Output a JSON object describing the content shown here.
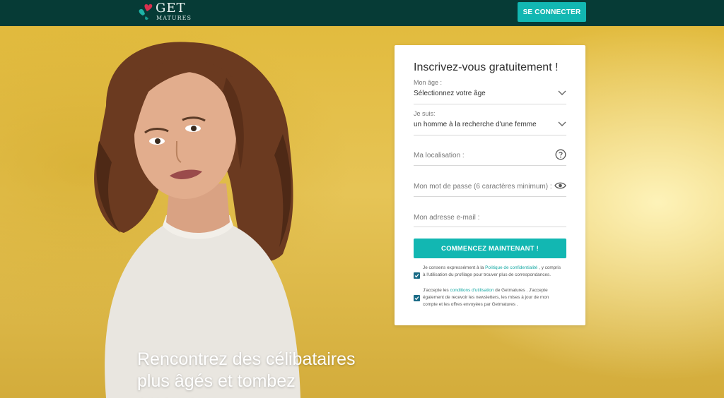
{
  "header": {
    "logo_word": "GET",
    "logo_sub": "MATURES",
    "login_button": "SE CONNECTER"
  },
  "hero": {
    "headline": "Rencontrez des célibataires plus âgés et tombez amoureux"
  },
  "form": {
    "title": "Inscrivez-vous gratuitement !",
    "age_label": "Mon âge :",
    "age_value": "Sélectionnez votre âge",
    "iam_label": "Je suis:",
    "iam_value": "un homme à la recherche d'une femme",
    "location_placeholder": "Ma localisation :",
    "password_placeholder": "Mon mot de passe (6 caractères minimum) :",
    "email_placeholder": "Mon adresse e-mail :",
    "submit_label": "COMMENCEZ MAINTENANT !",
    "consent1_pre": "Je consens expressément à la ",
    "consent1_link": "Politique de confidentialité",
    "consent1_post": " , y compris à l'utilisation du profilage pour trouver plus de correspondances.",
    "consent2_pre": "J'accepte les ",
    "consent2_link": "conditions d'utilisation",
    "consent2_post": " de Getmatures . J'accepte également de recevoir les newsletters, les mises à jour de mon compte et les offres envoyées par Getmatures ."
  },
  "colors": {
    "header_bg": "#063b36",
    "accent_teal": "#12b7b2",
    "checkbox": "#1a6b86",
    "hero_yellow": "#e4be4a"
  },
  "icons": [
    "heart-clover-logo-icon",
    "chevron-down-icon",
    "help-circle-icon",
    "eye-icon",
    "check-icon"
  ]
}
